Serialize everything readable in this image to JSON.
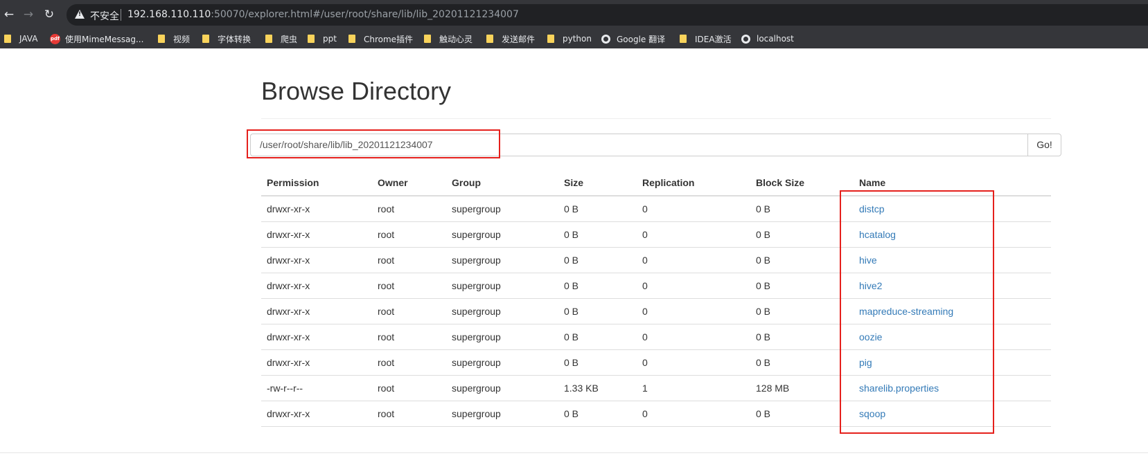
{
  "browser": {
    "insecure_label": "不安全",
    "url_host": "192.168.110.110",
    "url_rest": ":50070/explorer.html#/user/root/share/lib/lib_20201121234007",
    "bookmarks": [
      {
        "icon": "folder-icon",
        "label": "JAVA"
      },
      {
        "icon": "pdf-icon",
        "label": "使用MimeMessag..."
      },
      {
        "icon": "folder-icon",
        "label": "视频"
      },
      {
        "icon": "folder-icon",
        "label": "字体转换"
      },
      {
        "icon": "folder-icon",
        "label": "爬虫"
      },
      {
        "icon": "folder-icon",
        "label": "ppt"
      },
      {
        "icon": "folder-icon",
        "label": "Chrome插件"
      },
      {
        "icon": "folder-icon",
        "label": "触动心灵"
      },
      {
        "icon": "folder-icon",
        "label": "发送邮件"
      },
      {
        "icon": "folder-icon",
        "label": "python"
      },
      {
        "icon": "globe-icon",
        "label": "Google 翻译"
      },
      {
        "icon": "folder-icon",
        "label": "IDEA激活"
      },
      {
        "icon": "globe-icon",
        "label": "localhost"
      }
    ]
  },
  "page": {
    "title": "Browse Directory",
    "path_value": "/user/root/share/lib/lib_20201121234007",
    "go_label": "Go!"
  },
  "table": {
    "headers": [
      "Permission",
      "Owner",
      "Group",
      "Size",
      "Replication",
      "Block Size",
      "Name"
    ],
    "rows": [
      [
        "drwxr-xr-x",
        "root",
        "supergroup",
        "0 B",
        "0",
        "0 B",
        "distcp"
      ],
      [
        "drwxr-xr-x",
        "root",
        "supergroup",
        "0 B",
        "0",
        "0 B",
        "hcatalog"
      ],
      [
        "drwxr-xr-x",
        "root",
        "supergroup",
        "0 B",
        "0",
        "0 B",
        "hive"
      ],
      [
        "drwxr-xr-x",
        "root",
        "supergroup",
        "0 B",
        "0",
        "0 B",
        "hive2"
      ],
      [
        "drwxr-xr-x",
        "root",
        "supergroup",
        "0 B",
        "0",
        "0 B",
        "mapreduce-streaming"
      ],
      [
        "drwxr-xr-x",
        "root",
        "supergroup",
        "0 B",
        "0",
        "0 B",
        "oozie"
      ],
      [
        "drwxr-xr-x",
        "root",
        "supergroup",
        "0 B",
        "0",
        "0 B",
        "pig"
      ],
      [
        "-rw-r--r--",
        "root",
        "supergroup",
        "1.33 KB",
        "1",
        "128 MB",
        "sharelib.properties"
      ],
      [
        "drwxr-xr-x",
        "root",
        "supergroup",
        "0 B",
        "0",
        "0 B",
        "sqoop"
      ]
    ]
  },
  "colors": {
    "link": "#337ab7",
    "highlight": "#e5201c",
    "chrome_bg": "#35363a"
  }
}
